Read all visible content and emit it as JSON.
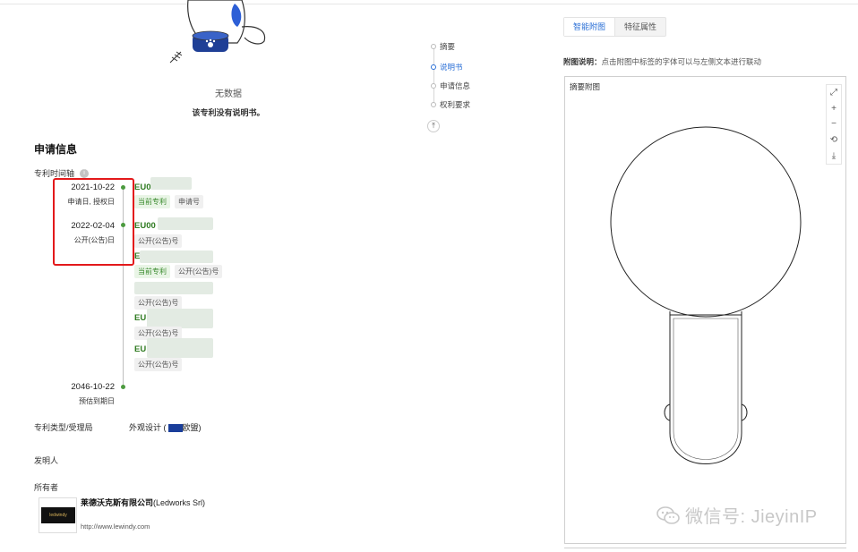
{
  "description_empty": {
    "text": "无数据",
    "sub": "该专利没有说明书。"
  },
  "section_title": "申请信息",
  "timeline": {
    "label": "专利时间轴",
    "entries": [
      {
        "date": "2021-10-22",
        "date_sub": "申请日, 授权日",
        "pub_no": "EU0",
        "tags": [
          "当前专利",
          "申请号"
        ]
      },
      {
        "date": "2022-02-04",
        "date_sub": "公开(公告)日",
        "pub_no": "EU00",
        "tags": [
          "公开(公告)号"
        ]
      },
      {
        "pub_no": "E",
        "tags": [
          "当前专利",
          "公开(公告)号"
        ]
      },
      {
        "tags": [
          "公开(公告)号"
        ]
      },
      {
        "pub_no": "EU",
        "tags": [
          "公开(公告)号"
        ]
      },
      {
        "pub_no": "EU",
        "tags": [
          "公开(公告)号"
        ]
      },
      {
        "date": "2046-10-22",
        "date_sub": "预估到期日"
      }
    ]
  },
  "patent_type": {
    "label": "专利类型/受理局",
    "value": "外观设计 (",
    "region": "欧盟",
    "close": ")"
  },
  "inventor": {
    "label": "发明人"
  },
  "owner": {
    "label": "所有者",
    "logo_text": "ledwindy",
    "name_cn": "莱德沃克斯有限公司",
    "name_en": "(Ledworks Srl)",
    "url": "http://www.lewindy.com"
  },
  "side_nav": {
    "items": [
      "摘要",
      "说明书",
      "申请信息",
      "权利要求"
    ],
    "active_index": 1,
    "top_icon": "arrow-up-to-top-icon"
  },
  "right_panel": {
    "tabs": [
      "智能附图",
      "特征属性"
    ],
    "active_tab": 0,
    "hint_label": "附图说明：",
    "hint_text": "点击附图中标签的字体可以与左侧文本进行联动",
    "figure_title": "摘要附图",
    "toolbar_icons": [
      "fullscreen-icon",
      "zoom-in-icon",
      "zoom-out-icon",
      "rotate-icon",
      "download-icon"
    ]
  },
  "watermark": "微信号: JieyinIP",
  "colors": {
    "accent": "#2a6fd6",
    "green": "#4c9a3f",
    "highlight": "#e3191b"
  }
}
